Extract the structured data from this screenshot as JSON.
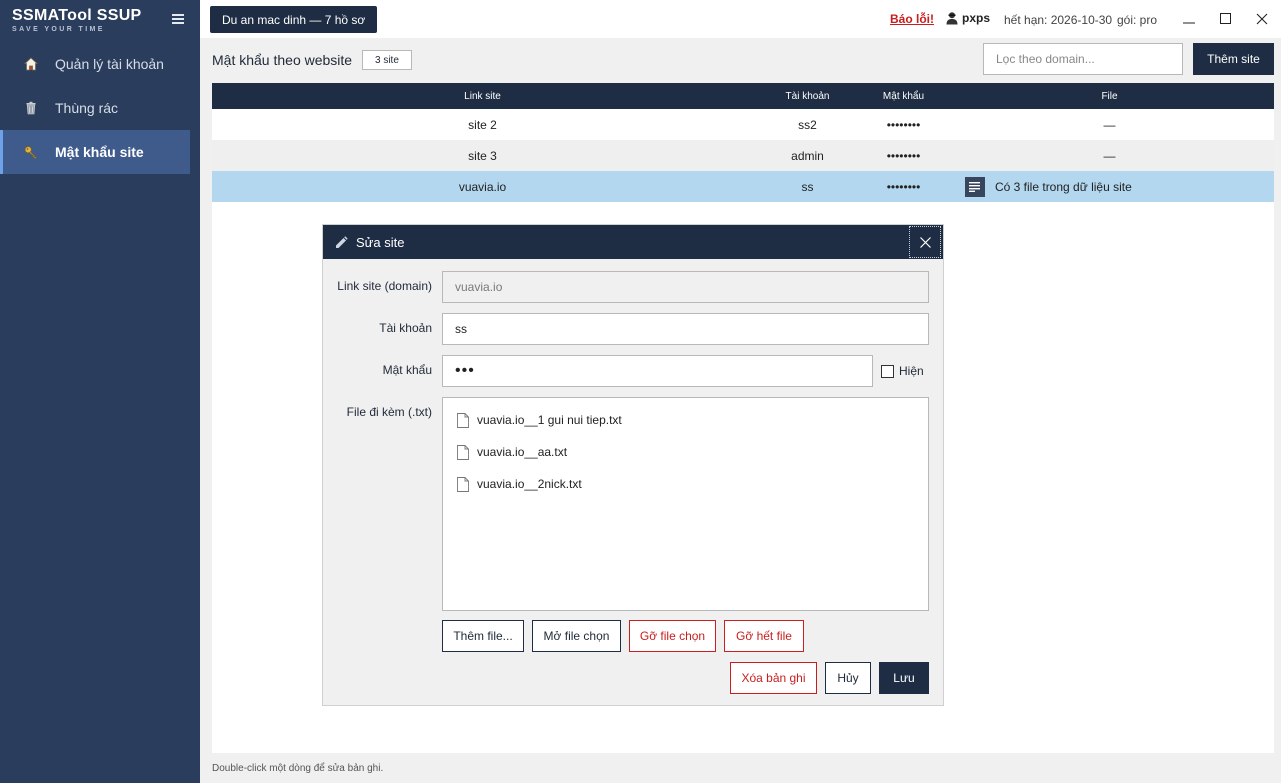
{
  "sidebar": {
    "brand_title": "SSMATool SSUP",
    "brand_subtitle": "SAVE YOUR TIME",
    "items": [
      {
        "label": "Quản lý tài khoản",
        "icon": "home-icon"
      },
      {
        "label": "Thùng rác",
        "icon": "trash-icon"
      },
      {
        "label": "Mật khẩu site",
        "icon": "key-icon",
        "active": true
      }
    ]
  },
  "topbar": {
    "project": "Du an mac dinh — 7 hồ sơ",
    "report_bug": "Báo lỗi!",
    "user": "pxps",
    "expiry": "hết hạn: 2026-10-30",
    "plan": "gói: pro"
  },
  "main": {
    "section_title": "Mật khẩu theo website",
    "count_badge": "3 site",
    "filter_placeholder": "Lọc theo domain...",
    "add_site": "Thêm site",
    "columns": [
      "Link site",
      "Tài khoản",
      "Mật khẩu",
      "File"
    ],
    "rows": [
      {
        "site": "site 2",
        "account": "ss2",
        "password": "••••••••",
        "file": "—"
      },
      {
        "site": "site 3",
        "account": "admin",
        "password": "••••••••",
        "file": "—"
      },
      {
        "site": "vuavia.io",
        "account": "ss",
        "password": "••••••••",
        "file": "Có 3 file trong dữ liệu site"
      }
    ],
    "status": "Double-click một dòng để sửa bản ghi."
  },
  "dialog": {
    "title": "Sửa site",
    "label_domain": "Link site (domain)",
    "domain_value": "vuavia.io",
    "label_account": "Tài khoản",
    "account_value": "ss",
    "label_password": "Mật khẩu",
    "password_value": "•••",
    "show_label": "Hiện",
    "label_files": "File đi kèm (.txt)",
    "files": [
      "vuavia.io__1 gui nui tiep.txt",
      "vuavia.io__aa.txt",
      "vuavia.io__2nick.txt"
    ],
    "btn_add_file": "Thêm file...",
    "btn_open_file": "Mở file chọn",
    "btn_remove_selected": "Gỡ file chọn",
    "btn_remove_all": "Gỡ hết file",
    "btn_delete_record": "Xóa bản ghi",
    "btn_cancel": "Hủy",
    "btn_save": "Lưu"
  },
  "colors": {
    "sidebar_bg": "#2b3d5c",
    "sidebar_active": "#3e5b8c",
    "header_dark": "#1f2d44",
    "danger": "#c81e1e",
    "selected_row": "#b3d7ee"
  }
}
